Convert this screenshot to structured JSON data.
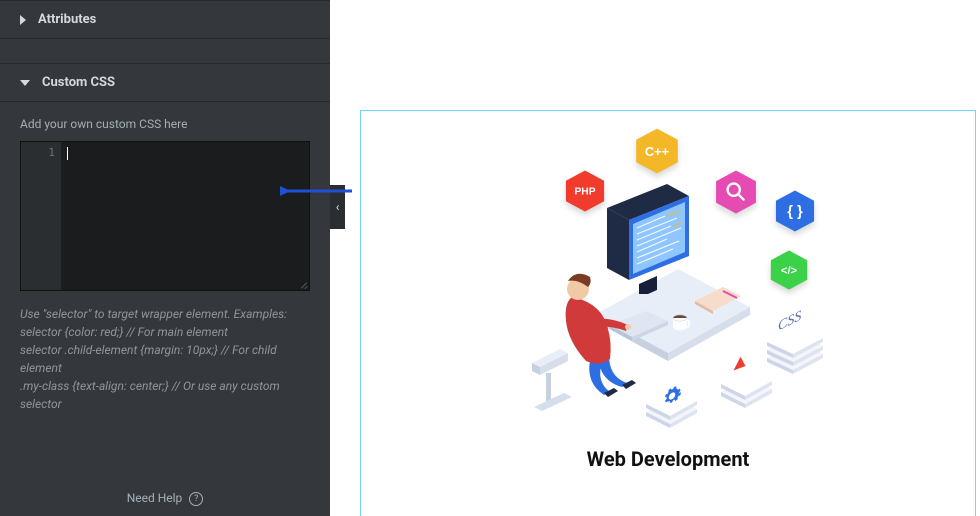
{
  "sidebar": {
    "panels": {
      "attributes": {
        "label": "Attributes",
        "expanded": false
      },
      "custom_css": {
        "label": "Custom CSS",
        "expanded": true,
        "hint": "Add your own custom CSS here",
        "editor": {
          "line_number": "1",
          "value": ""
        },
        "help": "Use \"selector\" to target wrapper element. Examples:\nselector {color: red;} // For main element\nselector .child-element {margin: 10px;} // For child element\n.my-class {text-align: center;} // Or use any custom selector"
      }
    },
    "footer": {
      "need_help": "Need Help",
      "help_icon": "?"
    }
  },
  "preview": {
    "caption": "Web Development",
    "badges": {
      "php": "PHP",
      "cpp": "C++",
      "search": "search",
      "curly": "{ }",
      "tag": "</>"
    },
    "stack_label": "CSS"
  },
  "colors": {
    "accent": "#71d7f7",
    "arrow": "#1f4fd6"
  }
}
